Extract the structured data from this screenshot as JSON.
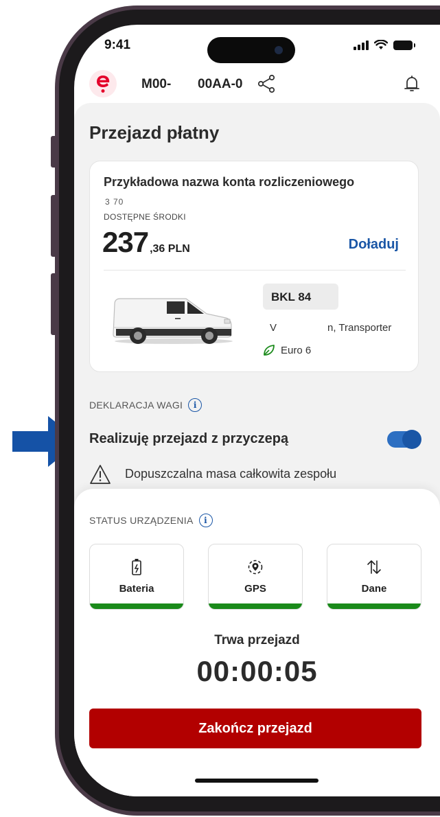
{
  "colors": {
    "brand_red": "#e4002b",
    "accent_blue": "#1a56a6",
    "end_button": "#b20000",
    "status_ok": "#1a8a1a"
  },
  "status_bar": {
    "time": "9:41"
  },
  "header": {
    "plate_left": "M00-",
    "plate_right": "00AA-0",
    "share_icon": "share-icon",
    "bell_icon": "bell-icon"
  },
  "page": {
    "title": "Przejazd płatny"
  },
  "account": {
    "name": "Przykładowa nazwa konta rozliczeniowego",
    "number": "3  70",
    "funds_label": "DOSTĘPNE ŚRODKI",
    "amount_int": "237",
    "amount_dec": ",36 PLN",
    "topup_label": "Doładuj"
  },
  "vehicle": {
    "plate": "BKL    84",
    "model_part1": "V",
    "model_part2": "n, Transporter",
    "emission": "Euro 6"
  },
  "weight": {
    "section_label": "DEKLARACJA WAGI",
    "trailer_label": "Realizuję przejazd z przyczepą",
    "trailer_on": true,
    "warning": "Dopuszczalna masa całkowita zespołu"
  },
  "device": {
    "section_label": "STATUS URZĄDZENIA",
    "tiles": [
      {
        "label": "Bateria",
        "icon": "battery-charging-icon"
      },
      {
        "label": "GPS",
        "icon": "gps-icon"
      },
      {
        "label": "Dane",
        "icon": "data-transfer-icon"
      }
    ]
  },
  "ride": {
    "status": "Trwa przejazd",
    "time": "00:00:05",
    "end_label": "Zakończ przejazd"
  }
}
